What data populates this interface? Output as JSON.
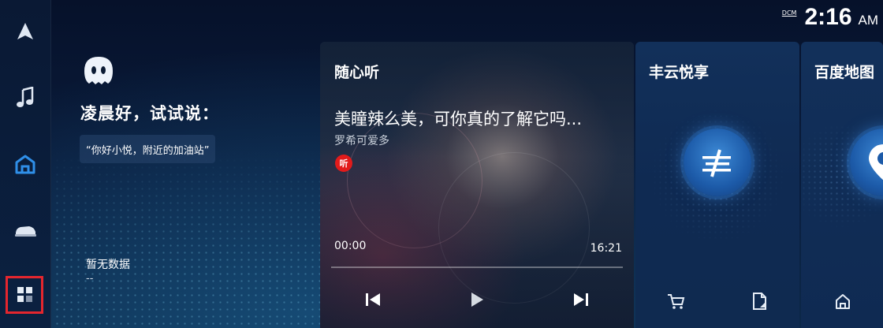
{
  "status": {
    "network_label": "DCM",
    "time": "2:16",
    "ampm": "AM"
  },
  "sidebar": {
    "items": [
      {
        "name": "navigation",
        "icon": "navigation-arrow-icon"
      },
      {
        "name": "music",
        "icon": "music-note-icon"
      },
      {
        "name": "home",
        "icon": "home-icon",
        "active": true
      },
      {
        "name": "vehicle",
        "icon": "car-icon"
      },
      {
        "name": "apps",
        "icon": "apps-grid-icon",
        "highlighted": true
      }
    ]
  },
  "assistant": {
    "greeting": "凌晨好，试试说：",
    "hint": "“你好小悦，附近的加油站”",
    "empty_title": "暂无数据",
    "empty_sub": "--"
  },
  "music_card": {
    "title": "随心听",
    "song": "美瞳辣么美，可你真的了解它吗...",
    "artist": "罗希可爱多",
    "source_badge": "听",
    "time_current": "00:00",
    "time_total": "16:21",
    "progress": 0,
    "colors": {
      "badge": "#e21b1b"
    }
  },
  "fengyun_card": {
    "title": "丰云悦享"
  },
  "baidu_card": {
    "title": "百度地图"
  },
  "colors": {
    "accent": "#2f8fe8",
    "highlight_box": "#e5262e"
  }
}
